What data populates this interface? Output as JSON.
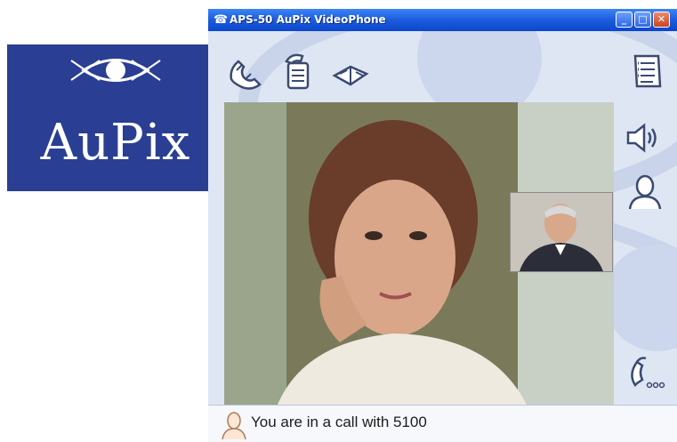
{
  "logo": {
    "text": "AuPix",
    "background": "#2a3f93"
  },
  "window": {
    "title": "APS-50 AuPix VideoPhone",
    "app_icon": "phone-icon",
    "controls": {
      "minimize": "minimize-icon",
      "maximize": "maximize-icon",
      "close": "close-icon"
    }
  },
  "toolbar": {
    "items": [
      {
        "name": "hangup-handset-icon"
      },
      {
        "name": "answer-handset-icon"
      },
      {
        "name": "phonebook-icon"
      }
    ],
    "right_item": "contact-list-icon"
  },
  "side_controls": [
    "speaker-icon",
    "contact-icon",
    "dial-pad-icon"
  ],
  "video": {
    "main": "remote-video-feed",
    "pip": "local-video-preview"
  },
  "status": {
    "text": "You are in a call with 5100",
    "icon": "person-icon"
  },
  "colors": {
    "title_bar": "#1f5ee0",
    "window_bg": "#dfe6f3",
    "icon_stroke": "#3a4a72"
  }
}
